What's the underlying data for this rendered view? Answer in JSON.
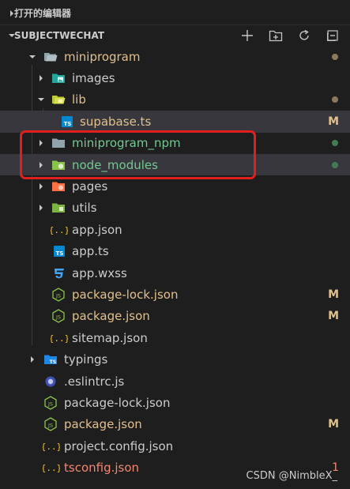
{
  "sections": {
    "open_editors": "打开的编辑器",
    "project": "SUBJECTWECHAT"
  },
  "toolbar_icons": [
    "new-file-icon",
    "new-folder-icon",
    "refresh-icon",
    "collapse-all-icon"
  ],
  "tree": [
    {
      "label": "miniprogram",
      "kind": "folder",
      "expanded": true,
      "color": "orange",
      "status": "dot",
      "icon": "folder-open-icon",
      "name": "tree-folder-miniprogram"
    },
    {
      "label": "images",
      "kind": "folder",
      "expanded": false,
      "color": "plain",
      "status": "",
      "icon": "images-folder-icon",
      "name": "tree-folder-images"
    },
    {
      "label": "lib",
      "kind": "folder",
      "expanded": true,
      "color": "orange",
      "status": "dot",
      "icon": "lib-folder-icon",
      "name": "tree-folder-lib"
    },
    {
      "label": "supabase.ts",
      "kind": "file",
      "color": "orange",
      "status": "M",
      "icon": "typescript-file-icon",
      "name": "tree-file-supabase-ts",
      "selected": true
    },
    {
      "label": "miniprogram_npm",
      "kind": "folder",
      "expanded": false,
      "color": "green",
      "status": "dot",
      "icon": "folder-icon",
      "name": "tree-folder-miniprogram-npm"
    },
    {
      "label": "node_modules",
      "kind": "folder",
      "expanded": false,
      "color": "green",
      "status": "dot",
      "icon": "node-folder-icon",
      "name": "tree-folder-node-modules",
      "selected": true
    },
    {
      "label": "pages",
      "kind": "folder",
      "expanded": false,
      "color": "plain",
      "status": "",
      "icon": "pages-folder-icon",
      "name": "tree-folder-pages"
    },
    {
      "label": "utils",
      "kind": "folder",
      "expanded": false,
      "color": "plain",
      "status": "",
      "icon": "utils-folder-icon",
      "name": "tree-folder-utils"
    },
    {
      "label": "app.json",
      "kind": "file",
      "color": "plain",
      "status": "",
      "icon": "json-file-icon",
      "name": "tree-file-app-json"
    },
    {
      "label": "app.ts",
      "kind": "file",
      "color": "plain",
      "status": "",
      "icon": "typescript-file-icon",
      "name": "tree-file-app-ts"
    },
    {
      "label": "app.wxss",
      "kind": "file",
      "color": "plain",
      "status": "",
      "icon": "css-file-icon",
      "name": "tree-file-app-wxss"
    },
    {
      "label": "package-lock.json",
      "kind": "file",
      "color": "orange",
      "status": "M",
      "icon": "nodejs-file-icon",
      "name": "tree-file-package-lock-json"
    },
    {
      "label": "package.json",
      "kind": "file",
      "color": "orange",
      "status": "M",
      "icon": "nodejs-file-icon",
      "name": "tree-file-package-json"
    },
    {
      "label": "sitemap.json",
      "kind": "file",
      "color": "plain",
      "status": "",
      "icon": "json-file-icon",
      "name": "tree-file-sitemap-json"
    },
    {
      "label": "typings",
      "kind": "folder",
      "expanded": false,
      "color": "plain",
      "status": "",
      "icon": "typings-folder-icon",
      "name": "tree-folder-typings"
    },
    {
      "label": ".eslintrc.js",
      "kind": "file",
      "color": "plain",
      "status": "",
      "icon": "eslint-file-icon",
      "name": "tree-file-eslintrc"
    },
    {
      "label": "package-lock.json",
      "kind": "file",
      "color": "plain",
      "status": "",
      "icon": "nodejs-file-icon",
      "name": "tree-file-root-package-lock-json"
    },
    {
      "label": "package.json",
      "kind": "file",
      "color": "orange",
      "status": "M",
      "icon": "nodejs-file-icon",
      "name": "tree-file-root-package-json"
    },
    {
      "label": "project.config.json",
      "kind": "file",
      "color": "plain",
      "status": "",
      "icon": "json-file-icon",
      "name": "tree-file-project-config-json"
    },
    {
      "label": "tsconfig.json",
      "kind": "file",
      "color": "red",
      "status": "1",
      "icon": "json-file-icon",
      "name": "tree-file-tsconfig-json"
    }
  ],
  "colors": {
    "modified": "#e2c08d",
    "untracked": "#73c991",
    "error": "#f48771",
    "dot_modified": "#8c7a5e",
    "dot_green": "#447a55",
    "highlight_box": "#e02020"
  },
  "watermark": "CSDN @NimbleX_"
}
